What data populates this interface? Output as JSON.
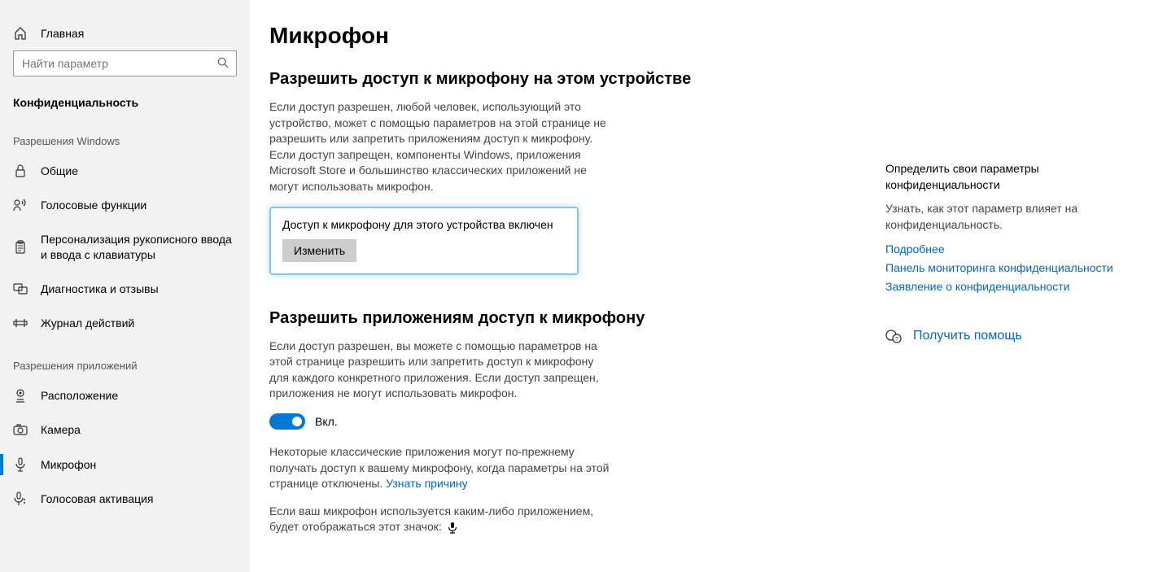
{
  "sidebar": {
    "home": "Главная",
    "search_placeholder": "Найти параметр",
    "category": "Конфиденциальность",
    "section_win": "Разрешения Windows",
    "win_items": [
      {
        "label": "Общие"
      },
      {
        "label": "Голосовые функции"
      },
      {
        "label": "Персонализация рукописного ввода и ввода с клавиатуры"
      },
      {
        "label": "Диагностика и отзывы"
      },
      {
        "label": "Журнал действий"
      }
    ],
    "section_apps": "Разрешения приложений",
    "app_items": [
      {
        "label": "Расположение"
      },
      {
        "label": "Камера"
      },
      {
        "label": "Микрофон"
      },
      {
        "label": "Голосовая активация"
      }
    ]
  },
  "main": {
    "title": "Микрофон",
    "h2a": "Разрешить доступ к микрофону на этом устройстве",
    "p1": "Если доступ разрешен, любой человек, использующий это устройство, может с помощью параметров на этой странице не разрешить или запретить приложениям доступ к микрофону. Если доступ запрещен, компоненты Windows, приложения Microsoft Store и большинство классических приложений не могут использовать микрофон.",
    "callout_status": "Доступ к микрофону для этого устройства включен",
    "change_btn": "Изменить",
    "h2b": "Разрешить приложениям доступ к микрофону",
    "p2": "Если доступ разрешен, вы можете с помощью параметров на этой странице разрешить или запретить доступ к микрофону для каждого конкретного приложения. Если доступ запрещен, приложения не могут использовать микрофон.",
    "toggle_label": "Вкл.",
    "p3a": "Некоторые классические приложения могут по-прежнему получать доступ к вашему микрофону, когда параметры на этой странице отключены. ",
    "p3_link": "Узнать причину",
    "p4": "Если ваш микрофон используется каким-либо приложением, будет отображаться этот значок:"
  },
  "right": {
    "title": "Определить свои параметры конфиденциальности",
    "sub": "Узнать, как этот параметр влияет на конфиденциальность.",
    "link1": "Подробнее",
    "link2": "Панель мониторинга конфиденциальности",
    "link3": "Заявление о конфиденциальности",
    "help": "Получить помощь"
  }
}
